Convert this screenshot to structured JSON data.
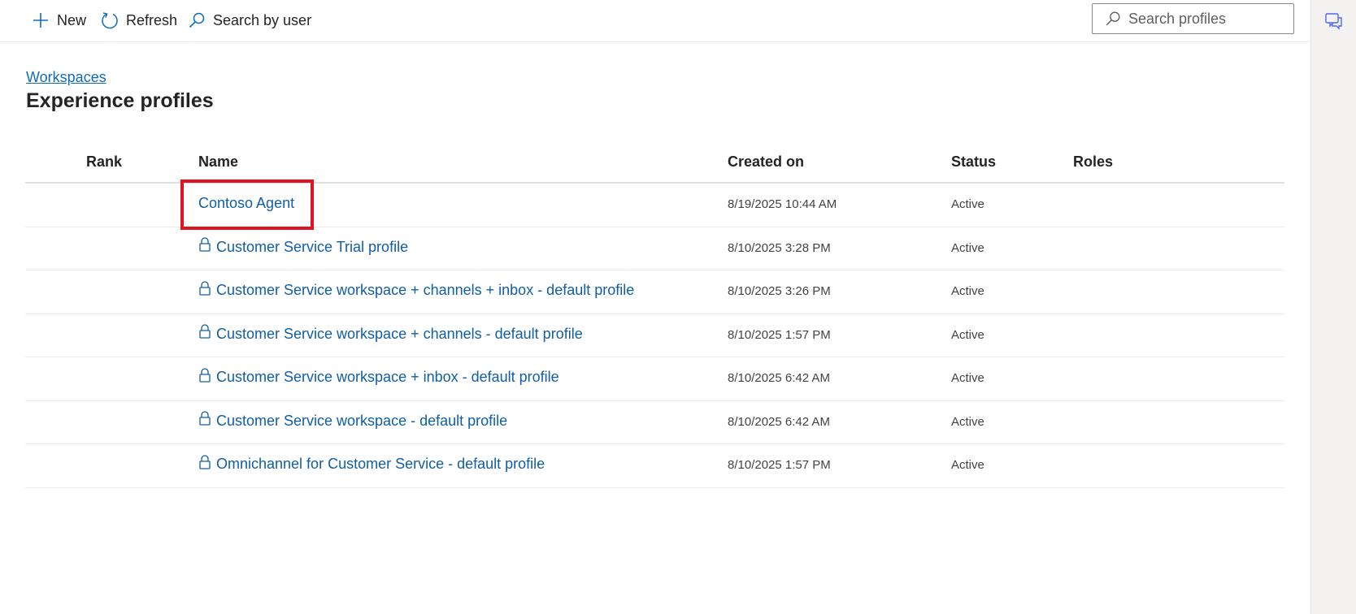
{
  "toolbar": {
    "new_label": "New",
    "refresh_label": "Refresh",
    "search_by_user_label": "Search by user",
    "search_placeholder": "Search profiles"
  },
  "breadcrumb": "Workspaces",
  "page_title": "Experience profiles",
  "columns": {
    "rank": "Rank",
    "name": "Name",
    "created_on": "Created on",
    "status": "Status",
    "roles": "Roles"
  },
  "rows": [
    {
      "name": "Contoso Agent",
      "created_on": "8/19/2025 10:44 AM",
      "status": "Active",
      "locked": false
    },
    {
      "name": "Customer Service Trial profile",
      "created_on": "8/10/2025 3:28 PM",
      "status": "Active",
      "locked": true
    },
    {
      "name": "Customer Service workspace + channels + inbox - default profile",
      "created_on": "8/10/2025 3:26 PM",
      "status": "Active",
      "locked": true
    },
    {
      "name": "Customer Service workspace + channels - default profile",
      "created_on": "8/10/2025 1:57 PM",
      "status": "Active",
      "locked": true
    },
    {
      "name": "Customer Service workspace + inbox - default profile",
      "created_on": "8/10/2025 6:42 AM",
      "status": "Active",
      "locked": true
    },
    {
      "name": "Customer Service workspace - default profile",
      "created_on": "8/10/2025 6:42 AM",
      "status": "Active",
      "locked": true
    },
    {
      "name": "Omnichannel for Customer Service - default profile",
      "created_on": "8/10/2025 1:57 PM",
      "status": "Active",
      "locked": true
    }
  ],
  "colors": {
    "link": "#115ea3",
    "highlight": "#e0141e",
    "accent": "#0f6cbd"
  },
  "icons": {
    "new": "plus-icon",
    "refresh": "refresh-icon",
    "search_by_user": "search-icon",
    "search": "search-icon",
    "lock": "lock-icon",
    "rail": "chat-icon"
  }
}
